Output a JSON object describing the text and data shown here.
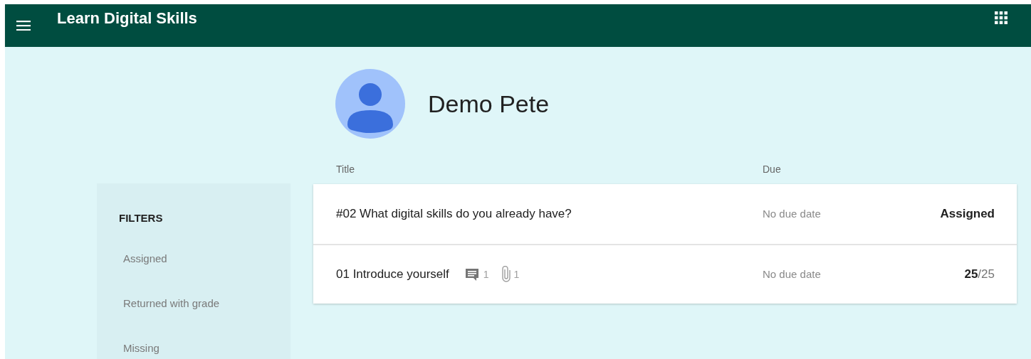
{
  "app_bar": {
    "title": "Learn Digital Skills"
  },
  "student": {
    "name": "Demo Pete"
  },
  "filters": {
    "heading": "FILTERS",
    "items": [
      {
        "label": "Assigned"
      },
      {
        "label": "Returned with grade"
      },
      {
        "label": "Missing"
      }
    ]
  },
  "table": {
    "columns": [
      "Title",
      "Due"
    ],
    "rows": [
      {
        "title": "#02 What digital skills do you already have?",
        "due": "No due date",
        "status": {
          "kind": "label",
          "text": "Assigned"
        }
      },
      {
        "title": "01 Introduce yourself",
        "comments": "1",
        "attachments": "1",
        "due": "No due date",
        "status": {
          "kind": "grade",
          "score": "25",
          "total": "/25"
        }
      }
    ]
  }
}
